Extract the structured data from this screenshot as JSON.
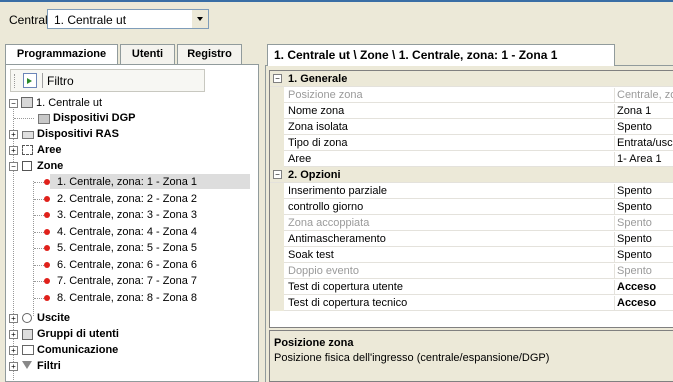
{
  "toolbar": {
    "centrale_label": "Centrale",
    "centrale_value": "1. Centrale ut"
  },
  "left_tabs": [
    "Programmazione",
    "Utenti",
    "Registro"
  ],
  "filter": {
    "label": "Filtro"
  },
  "tree": {
    "root": "1. Centrale ut",
    "items": [
      {
        "label": "Dispositivi DGP",
        "icon": "device-icon"
      },
      {
        "label": "Dispositivi RAS",
        "icon": "keypad-icon"
      },
      {
        "label": "Aree",
        "icon": "area-icon"
      },
      {
        "label": "Zone",
        "icon": "zone-icon"
      }
    ],
    "zones": [
      "1. Centrale, zona: 1  - Zona 1",
      "2. Centrale, zona: 2  - Zona 2",
      "3. Centrale, zona: 3  - Zona 3",
      "4. Centrale, zona: 4  - Zona 4",
      "5. Centrale, zona: 5  - Zona 5",
      "6. Centrale, zona: 6  - Zona 6",
      "7. Centrale, zona: 7  - Zona 7",
      "8. Centrale, zona: 8  - Zona 8"
    ],
    "after": [
      {
        "label": "Uscite",
        "icon": "output-icon"
      },
      {
        "label": "Gruppi di utenti",
        "icon": "user-group-icon"
      },
      {
        "label": "Comunicazione",
        "icon": "communication-icon"
      },
      {
        "label": "Filtri",
        "icon": "filter-icon"
      }
    ]
  },
  "right_tab": "1. Centrale ut \\ Zone \\ 1. Centrale, zona: 1  - Zona 1",
  "grid": {
    "generale_title": "1. Generale",
    "generale": [
      {
        "name": "Posizione zona",
        "value": "Centrale, zona",
        "disabled": true
      },
      {
        "name": "Nome zona",
        "value": "Zona 1"
      },
      {
        "name": "Zona isolata",
        "value": "Spento"
      },
      {
        "name": "Tipo di zona",
        "value": "Entrata/uscita"
      },
      {
        "name": "Aree",
        "value": "1- Area 1"
      }
    ],
    "opzioni_title": "2. Opzioni",
    "opzioni": [
      {
        "name": "Inserimento parziale",
        "value": "Spento"
      },
      {
        "name": "controllo giorno",
        "value": "Spento"
      },
      {
        "name": "Zona accoppiata",
        "value": "Spento",
        "disabled": true
      },
      {
        "name": "Antimascheramento",
        "value": "Spento"
      },
      {
        "name": "Soak test",
        "value": "Spento"
      },
      {
        "name": "Doppio evento",
        "value": "Spento",
        "disabled": true
      },
      {
        "name": "Test di copertura utente",
        "value": "Acceso",
        "bold": true
      },
      {
        "name": "Test di copertura tecnico",
        "value": "Acceso",
        "bold": true
      }
    ]
  },
  "description": {
    "title": "Posizione zona",
    "text": "Posizione fisica dell'ingresso (centrale/espansione/DGP)"
  },
  "colors": {
    "accent": "#3a6ea5",
    "selection": "#dddddd",
    "zone_dot": "#e0201a"
  }
}
